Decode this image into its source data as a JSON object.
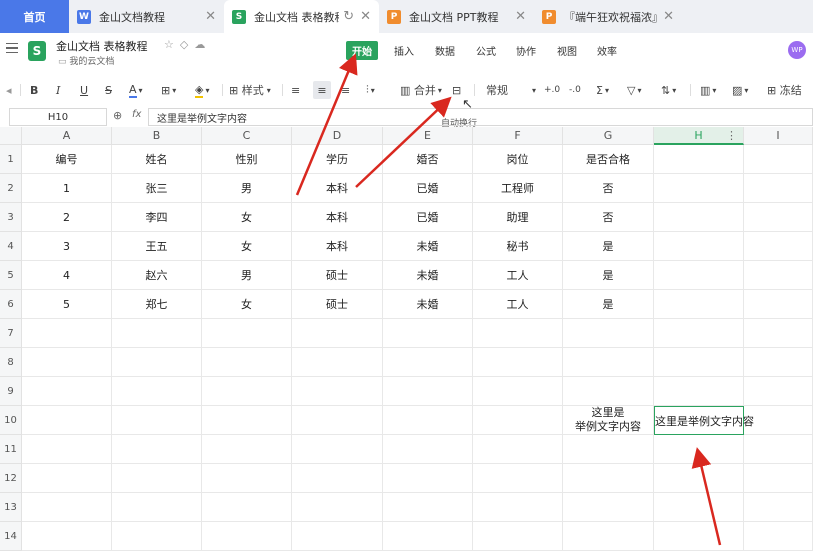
{
  "tabs": [
    {
      "label": "首页",
      "kind": "home"
    },
    {
      "label": "金山文档教程",
      "icon": "W",
      "icon_color": "#4a78e8"
    },
    {
      "label": "金山文档 表格教程",
      "icon": "S",
      "icon_color": "#2aa35e",
      "active": true
    },
    {
      "label": "金山文档 PPT教程",
      "icon": "P",
      "icon_color": "#f08c2e"
    },
    {
      "label": "『端午狂欢祝福浓』",
      "icon": "P",
      "icon_color": "#f08c2e"
    }
  ],
  "doc": {
    "title": "金山文档 表格教程",
    "location": "我的云文档",
    "icon_letter": "S"
  },
  "menu": [
    "开始",
    "插入",
    "数据",
    "公式",
    "协作",
    "视图",
    "效率"
  ],
  "avatar": "WP",
  "toolbar": {
    "style_label": "样式",
    "merge_label": "合并",
    "format_label": "常规",
    "freeze_label": "冻结",
    "tooltip": "自动换行"
  },
  "namebox": "H10",
  "formula": "这里是举例文字内容",
  "columns": [
    "A",
    "B",
    "C",
    "D",
    "E",
    "F",
    "G",
    "H",
    "I"
  ],
  "selected_column": "H",
  "rows": [
    "1",
    "2",
    "3",
    "4",
    "5",
    "6",
    "7",
    "8",
    "9",
    "10",
    "11",
    "12",
    "13",
    "14"
  ],
  "table": [
    [
      "编号",
      "姓名",
      "性别",
      "学历",
      "婚否",
      "岗位",
      "是否合格"
    ],
    [
      "1",
      "张三",
      "男",
      "本科",
      "已婚",
      "工程师",
      "否"
    ],
    [
      "2",
      "李四",
      "女",
      "本科",
      "已婚",
      "助理",
      "否"
    ],
    [
      "3",
      "王五",
      "女",
      "本科",
      "未婚",
      "秘书",
      "是"
    ],
    [
      "4",
      "赵六",
      "男",
      "硕士",
      "未婚",
      "工人",
      "是"
    ],
    [
      "5",
      "郑七",
      "女",
      "硕士",
      "未婚",
      "工人",
      "是"
    ]
  ],
  "g10": "这里是\n举例文字内容",
  "h10": "这里是举例文字内容",
  "colors": {
    "accent": "#2aa35e",
    "home_tab": "#4a78e8",
    "arrow": "#d9281f"
  }
}
